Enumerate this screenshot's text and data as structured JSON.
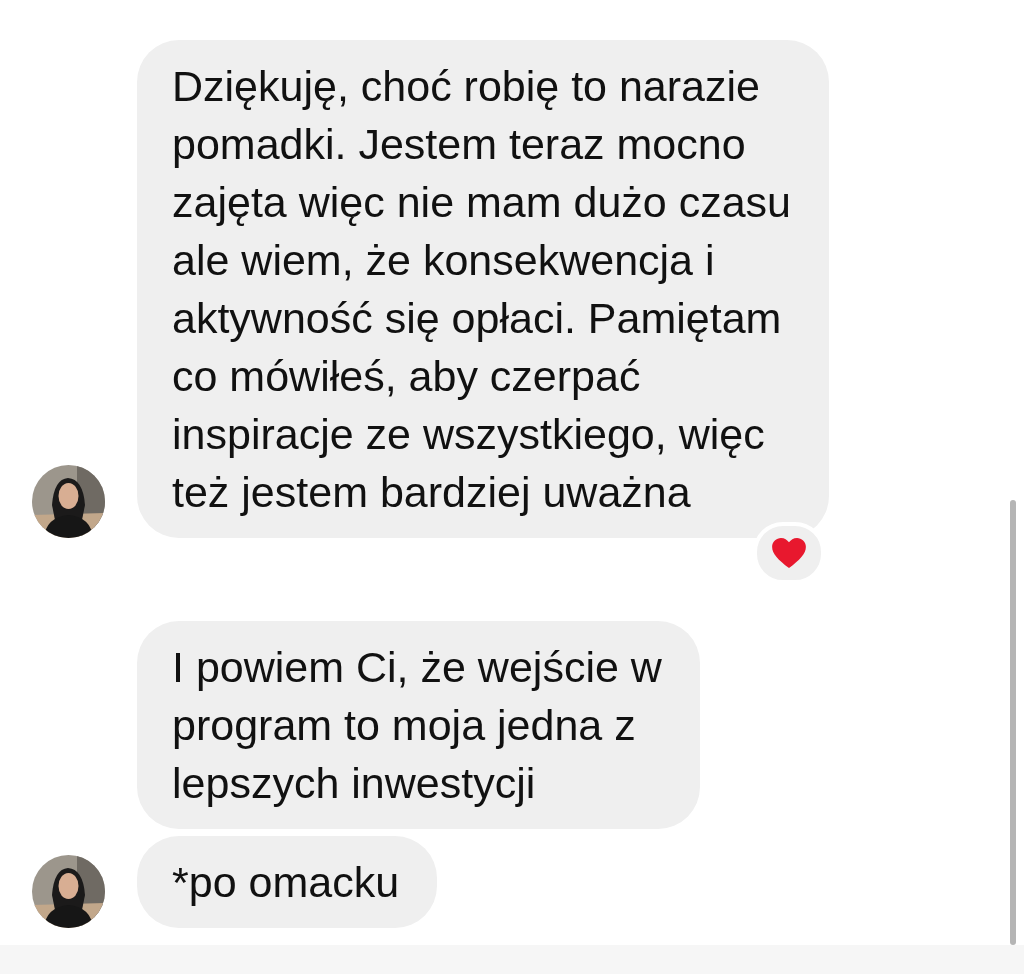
{
  "messages": [
    {
      "text": "Dziękuję, choć robię to narazie\npomadki. Jestem teraz mocno\nzajęta więc nie mam dużo czasu\nale wiem, że konsekwencja i\naktywność się opłaci. Pamiętam\nco mówiłeś, aby czerpać\ninspiracje ze wszystkiego, więc\nteż jestem bardziej uważna",
      "avatar": true,
      "reactions": [
        {
          "kind": "heart"
        }
      ]
    },
    {
      "text": "I powiem Ci, że wejście w\nprogram to moja jedna z\nlepszych inwestycji",
      "avatar": false
    },
    {
      "text": "*po omacku",
      "avatar": true
    }
  ]
}
